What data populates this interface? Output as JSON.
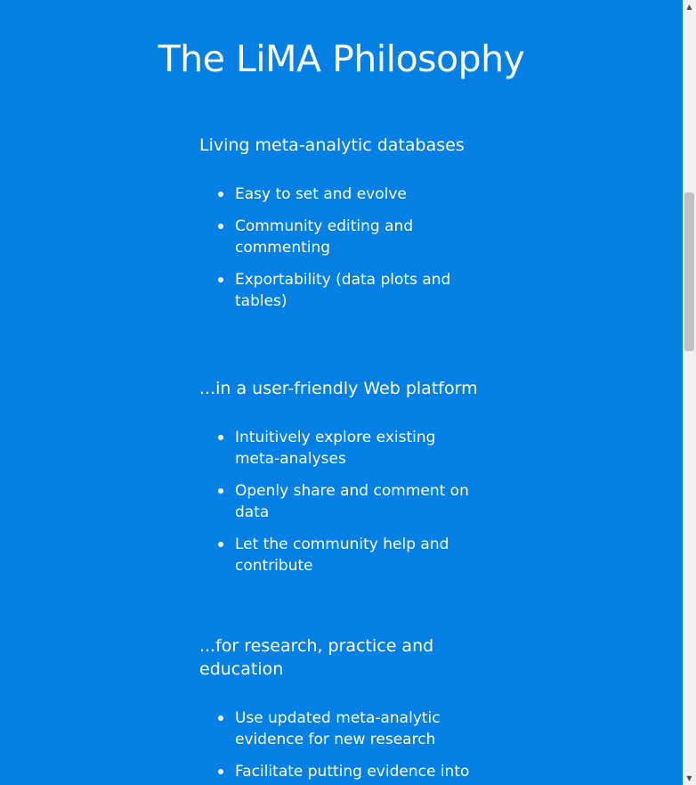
{
  "colors": {
    "background": "#0480e4",
    "text": "#ffffff",
    "scrollbar_track": "#f1f1f1",
    "scrollbar_thumb": "#c1c1c1"
  },
  "header": {
    "title": "The LiMA Philosophy"
  },
  "sections": [
    {
      "heading": "Living meta-analytic databases",
      "items": [
        "Easy to set and evolve",
        "Community editing and commenting",
        "Exportability (data plots and tables)"
      ]
    },
    {
      "heading": "...in a user-friendly Web platform",
      "items": [
        "Intuitively explore existing meta-analyses",
        "Openly share and comment on data",
        "Let the community help and contribute"
      ]
    },
    {
      "heading": "...for research, practice and education",
      "items": [
        "Use updated meta-analytic evidence for new research",
        "Facilitate putting evidence into"
      ]
    }
  ],
  "scrollbar": {
    "up_icon": "triangle-up-icon",
    "down_icon": "triangle-down-icon"
  }
}
